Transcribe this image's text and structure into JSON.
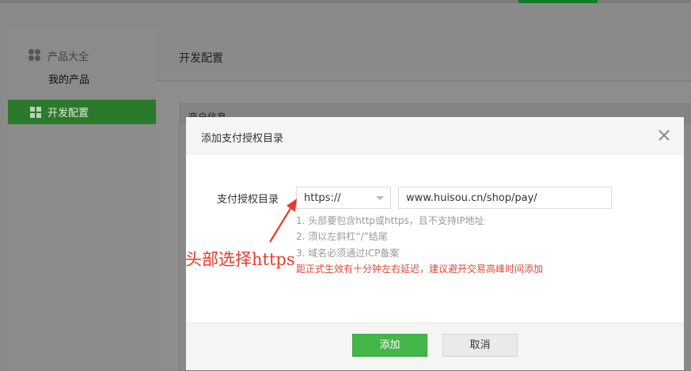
{
  "sidebar": {
    "group_head": {
      "label": "产品大全",
      "icon": "product-flower-icon"
    },
    "sub_item": {
      "label": "我的产品"
    },
    "active_item": {
      "label": "开发配置",
      "icon": "grid-icon"
    }
  },
  "main": {
    "title": "开发配置",
    "card_header": "商户信息"
  },
  "modal": {
    "title": "添加支付授权目录",
    "close_icon": "close-icon",
    "form": {
      "label": "支付授权目录",
      "protocol_select": {
        "selected": "https://"
      },
      "domain_input": {
        "value": "www.huisou.cn/shop/pay/"
      },
      "tips": [
        "1. 头部要包含http或https，且不支持IP地址",
        "2. 须以左斜杠“/”结尾",
        "3. 域名必须通过ICP备案"
      ],
      "warning": "距正式生效有十分钟左右延迟，建议避开交易高峰时间添加"
    },
    "buttons": {
      "confirm": "添加",
      "cancel": "取消"
    }
  },
  "annotation": {
    "text": "头部选择https",
    "color": "#e83a2e"
  },
  "colors": {
    "primary_green": "#44b549",
    "warning_red": "#e0493a",
    "sidebar_active": "#2b7a2b"
  }
}
